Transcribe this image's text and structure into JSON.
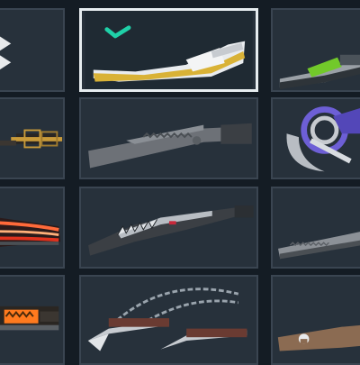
{
  "skin_grid": {
    "selected_index": 1,
    "items": [
      {
        "name": "chevron-emblem",
        "icon": "chevron-arrows-icon"
      },
      {
        "name": "gold-white-blade",
        "icon": "knife-icon",
        "accent": "#d8b23a"
      },
      {
        "name": "green-tech-blade",
        "icon": "knife-icon",
        "accent": "#7ccf2a"
      },
      {
        "name": "gold-frame-blade",
        "icon": "knife-icon",
        "accent": "#c89a3a"
      },
      {
        "name": "serrated-combat-knife",
        "icon": "knife-icon",
        "accent": "#8a8f95"
      },
      {
        "name": "karambit-purple",
        "icon": "karambit-icon",
        "accent": "#6d5fd6"
      },
      {
        "name": "red-glow-blade",
        "icon": "knife-icon",
        "accent": "#ff6a3a"
      },
      {
        "name": "crimson-serrated-blade",
        "icon": "knife-icon",
        "accent": "#c8283a"
      },
      {
        "name": "grey-serrated-blade",
        "icon": "knife-icon",
        "accent": "#8c9197"
      },
      {
        "name": "molten-blade",
        "icon": "knife-icon",
        "accent": "#ff7a1e"
      },
      {
        "name": "chain-kunai",
        "icon": "kunai-icon",
        "accent": "#9aa4ad"
      },
      {
        "name": "leather-lock-blade",
        "icon": "knife-icon",
        "accent": "#8b6b52"
      }
    ]
  }
}
